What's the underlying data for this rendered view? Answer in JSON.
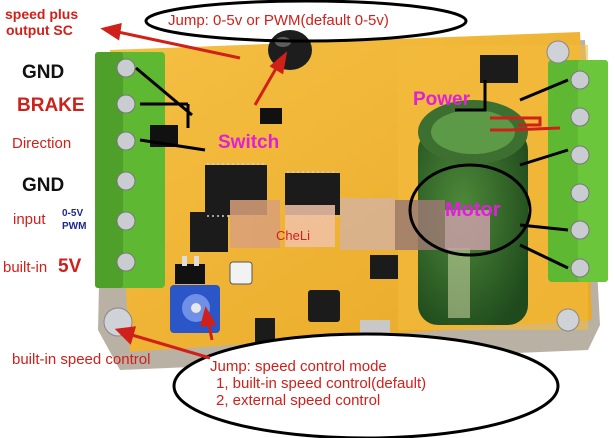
{
  "labels": {
    "speed_plus_output": [
      "speed plus",
      "output SC"
    ],
    "gnd_top": "GND",
    "brake": "BRAKE",
    "direction": "Direction",
    "gnd_bottom": "GND",
    "input": "input",
    "input_range": "0-5V",
    "input_pwm": "PWM",
    "builtin": "built-in",
    "builtin_voltage": "5V",
    "builtin_speed_control": "built-in speed control",
    "switch": "Switch",
    "power": "Power",
    "motor": "Motor",
    "watermark": "CheLi",
    "jump_top": "Jump: 0-5v or PWM(default 0-5v)",
    "jump_bottom": [
      "Jump: speed control mode",
      "1, built-in speed control(default)",
      "2, external speed control"
    ]
  },
  "colors": {
    "label_red": "#d0201a",
    "label_magenta": "#e020d8",
    "board": "#f0b32c",
    "terminal_green": "#5fb832",
    "capacitor_green": "#2f6a28",
    "pot_blue": "#2a56c8"
  }
}
